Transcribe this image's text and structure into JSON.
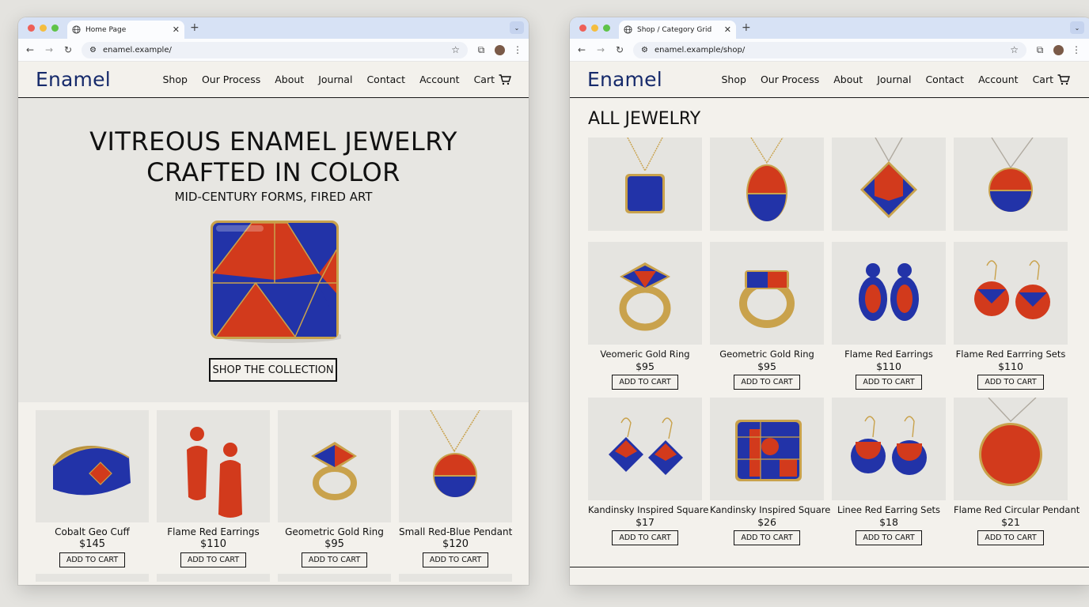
{
  "windows": [
    {
      "tab_title": "Home Page",
      "url": "enamel.example/",
      "site": {
        "logo": "Enamel",
        "nav": [
          "Shop",
          "Our Process",
          "About",
          "Journal",
          "Contact",
          "Account"
        ],
        "cart_label": "Cart"
      },
      "hero": {
        "title_line1": "VITREOUS ENAMEL JEWELRY",
        "title_line2": "CRAFTED IN COLOR",
        "subtitle": "MID-CENTURY FORMS, FIRED ART",
        "cta": "SHOP THE COLLECTION"
      },
      "products": [
        {
          "name": "Cobalt Geo Cuff",
          "price": "$145",
          "button": "ADD TO CART"
        },
        {
          "name": "Flame Red Earrings",
          "price": "$110",
          "button": "ADD TO CART"
        },
        {
          "name": "Geometric Gold Ring",
          "price": "$95",
          "button": "ADD TO CART"
        },
        {
          "name": "Small Red-Blue Pendant",
          "price": "$120",
          "button": "ADD TO CART"
        }
      ]
    },
    {
      "tab_title": "Shop / Category Grid",
      "url": "enamel.example/shop/",
      "site": {
        "logo": "Enamel",
        "nav": [
          "Shop",
          "Our Process",
          "About",
          "Journal",
          "Contact",
          "Account"
        ],
        "cart_label": "Cart"
      },
      "page_title": "ALL JEWELRY",
      "products_row2": [
        {
          "name": "Veomeric Gold Ring",
          "price": "$95",
          "button": "ADD TO CART"
        },
        {
          "name": "Geometric Gold Ring",
          "price": "$95",
          "button": "ADD TO CART"
        },
        {
          "name": "Flame Red Earrings",
          "price": "$110",
          "button": "ADD TO CART"
        },
        {
          "name": "Flame Red Earrring Sets",
          "price": "$110",
          "button": "ADD TO CART"
        }
      ],
      "products_row3": [
        {
          "name": "Kandinsky Inspired Square",
          "price": "$17",
          "button": "ADD TO CART"
        },
        {
          "name": "Kandinsky Inspired Square",
          "price": "$26",
          "button": "ADD TO CART"
        },
        {
          "name": "Linee Red Earring Sets",
          "price": "$18",
          "button": "ADD TO CART"
        },
        {
          "name": "Flame Red Circular Pendant",
          "price": "$21",
          "button": "ADD TO CART"
        }
      ]
    }
  ],
  "colors": {
    "cobalt": "#2233a8",
    "flame_red": "#d23a1c",
    "gold": "#c9a24c",
    "logo_navy": "#162a6b"
  }
}
